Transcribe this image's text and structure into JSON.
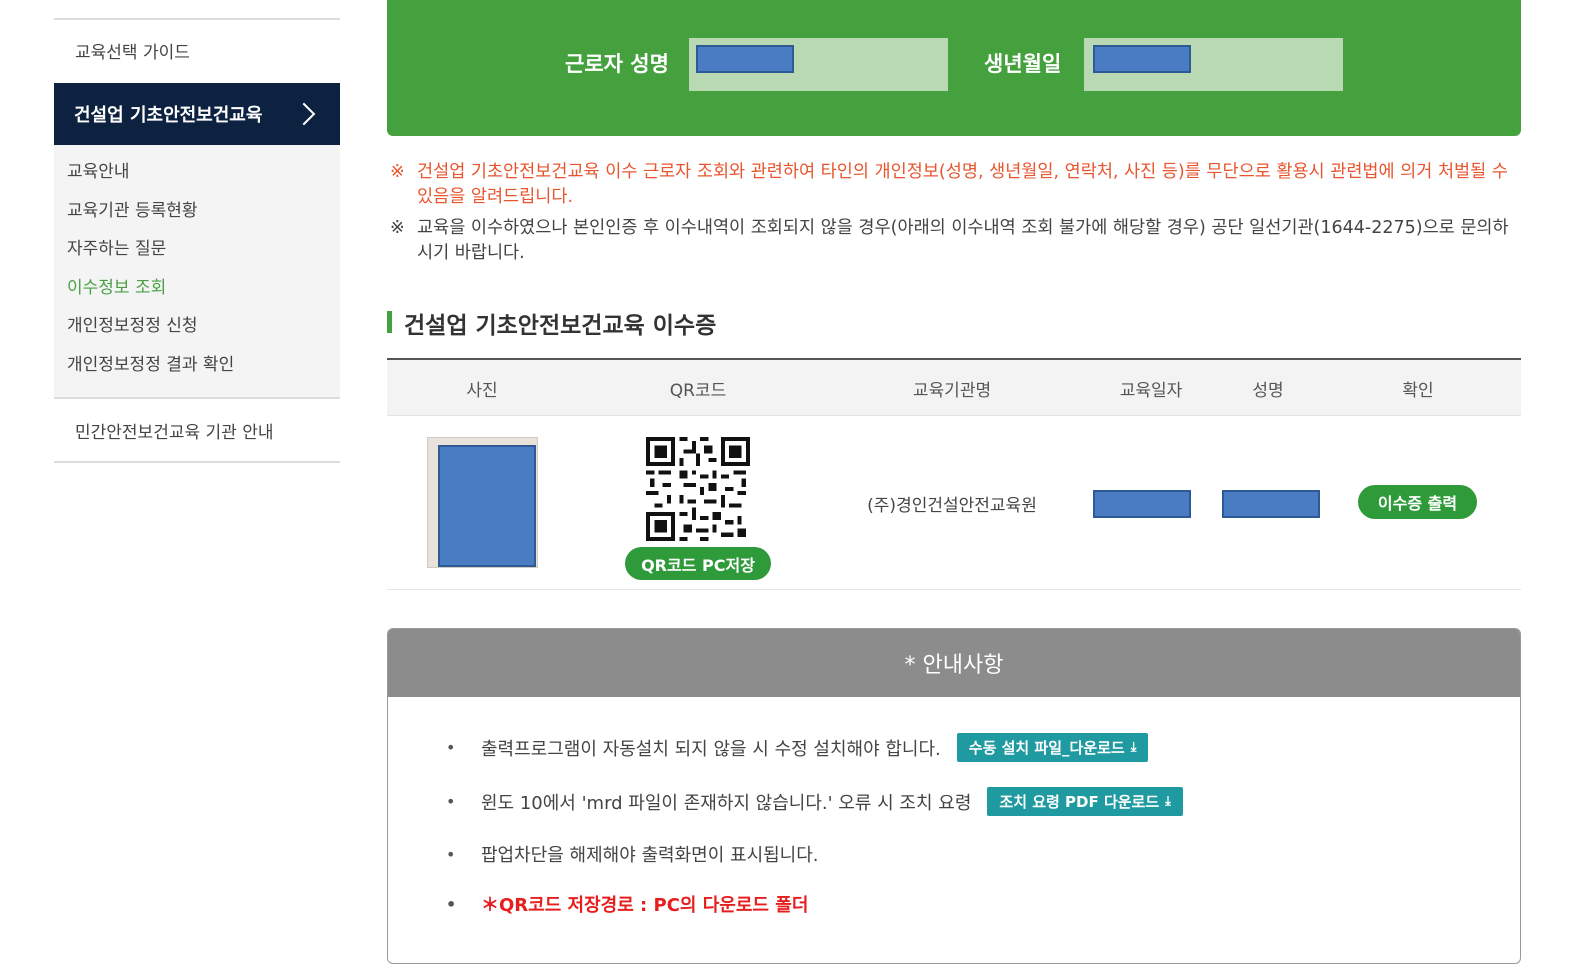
{
  "sidebar": {
    "guide": "교육선택 가이드",
    "active": "건설업 기초안전보건교육",
    "items": [
      "교육안내",
      "교육기관 등록현황",
      "자주하는 질문",
      "이수정보 조회",
      "개인정보정정 신청",
      "개인정보정정 결과 확인"
    ],
    "current_index": 3,
    "bottom_link": "민간안전보건교육 기관 안내"
  },
  "search": {
    "name_label": "근로자 성명",
    "birth_label": "생년월일"
  },
  "notices": [
    {
      "mark": "※",
      "text": "건설업 기초안전보건교육 이수 근로자 조회와 관련하여 타인의 개인정보(성명, 생년월일, 연락처, 사진 등)를 무단으로 활용시 관련법에 의거 처벌될 수 있음을 알려드립니다."
    },
    {
      "mark": "※",
      "text": "교육을 이수하였으나 본인인증 후 이수내역이 조회되지 않을 경우(아래의 이수내역 조회 불가에 해당할 경우) 공단 일선기관(1644-2275)으로 문의하시기 바랍니다."
    }
  ],
  "section_title": "건설업 기초안전보건교육 이수증",
  "table": {
    "headers": [
      "사진",
      "QR코드",
      "교육기관명",
      "교육일자",
      "성명",
      "확인"
    ],
    "row": {
      "org": "(주)경인건설안전교육원",
      "qr_button": "QR코드 PC저장",
      "print_button": "이수증 출력"
    }
  },
  "info": {
    "title": "* 안내사항",
    "items": [
      {
        "text": "출력프로그램이 자동설치 되지 않을 시 수정 설치해야 합니다.",
        "button": "수동 설치 파일_다운로드"
      },
      {
        "text": "윈도 10에서 'mrd 파일이 존재하지 않습니다.' 오류 시 조치 요령",
        "button": "조치 요령 PDF 다운로드"
      },
      {
        "text": "팝업차단을 해제해야 출력화면이 표시됩니다."
      },
      {
        "text": "＊QR코드 저장경로 : PC의 다운로드 폴더"
      }
    ],
    "bullet": "•",
    "download_icon": "⤓"
  },
  "colors": {
    "green": "#44a13e",
    "navy": "#0d2240",
    "teal": "#1f9aa0",
    "red": "#e61e1e",
    "mask": "#4a7cc4"
  }
}
